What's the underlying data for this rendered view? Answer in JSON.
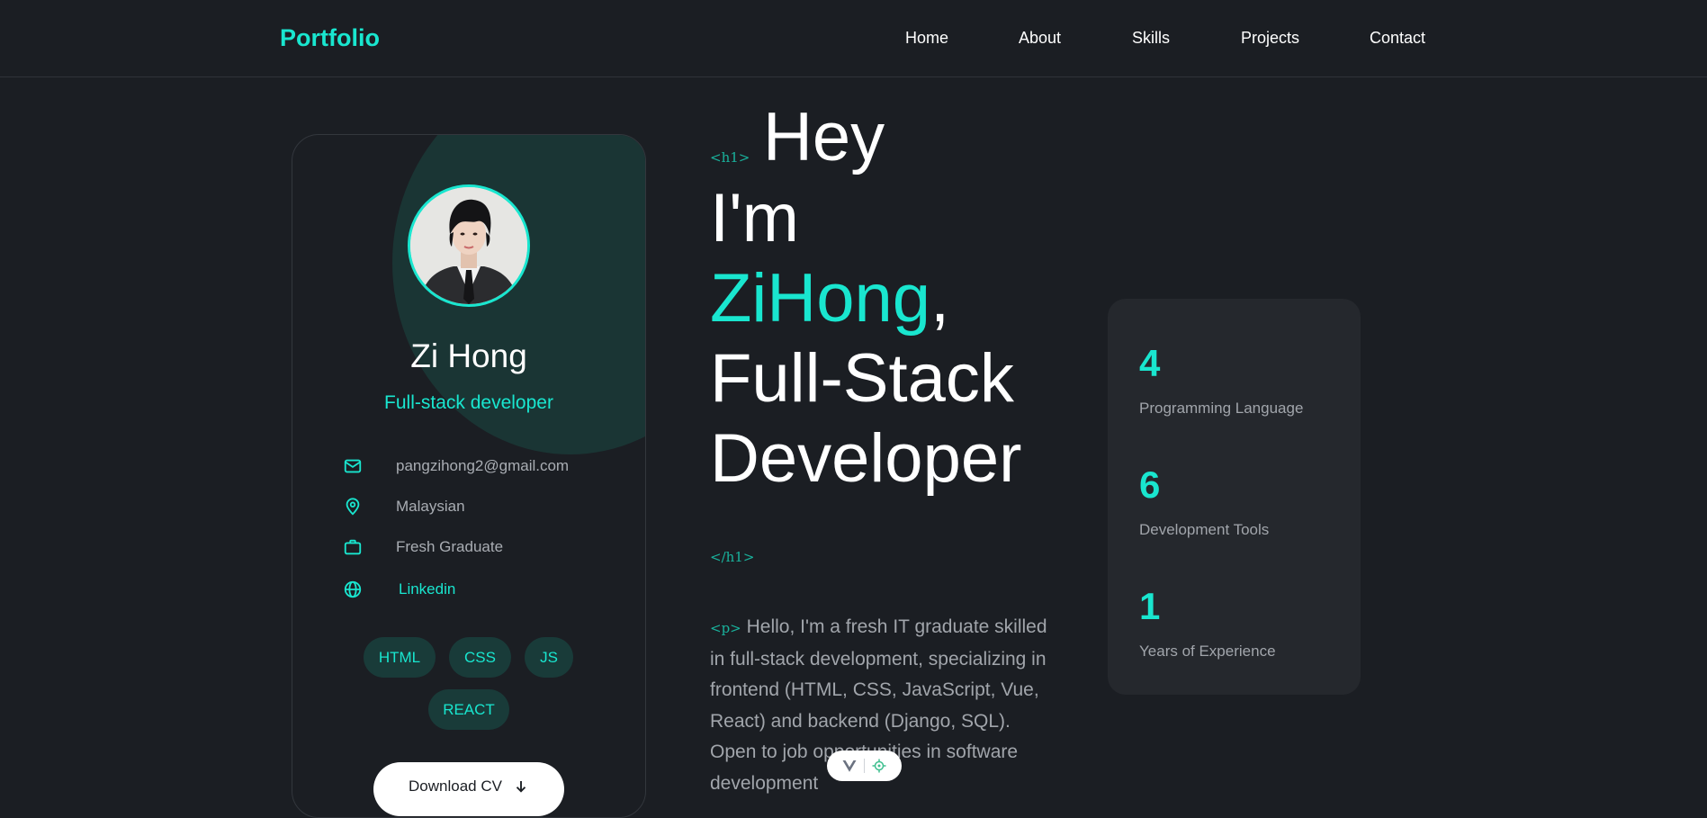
{
  "nav": {
    "logo": "Portfolio",
    "links": [
      "Home",
      "About",
      "Skills",
      "Projects",
      "Contact"
    ]
  },
  "profile": {
    "name": "Zi Hong",
    "role": "Full-stack developer",
    "info": [
      {
        "icon": "mail-icon",
        "text": "pangzihong2@gmail.com"
      },
      {
        "icon": "location-pin-icon",
        "text": "Malaysian"
      },
      {
        "icon": "briefcase-icon",
        "text": "Fresh Graduate"
      },
      {
        "icon": "globe-icon",
        "text": "Linkedin"
      }
    ],
    "tags": [
      "HTML",
      "CSS",
      "JS",
      "REACT"
    ],
    "download_label": "Download CV"
  },
  "hero": {
    "open_tag": "<h1>",
    "close_tag": "</h1>",
    "line1": "Hey",
    "line2": "I'm",
    "name": "ZiHong",
    "comma": ",",
    "line4": "Full-Stack",
    "line5": "Developer",
    "p_tag": "<p>",
    "intro": "Hello, I'm a fresh IT graduate skilled in full-stack development, specializing in frontend (HTML, CSS, JavaScript, Vue, React) and backend (Django, SQL). Open to job opportunities in software development"
  },
  "stats": [
    {
      "value": "4",
      "label": "Programming Language"
    },
    {
      "value": "6",
      "label": "Development Tools"
    },
    {
      "value": "1",
      "label": "Years of Experience"
    }
  ],
  "colors": {
    "accent": "#19e6cf",
    "background": "#1b1e23",
    "card": "#25282d"
  }
}
